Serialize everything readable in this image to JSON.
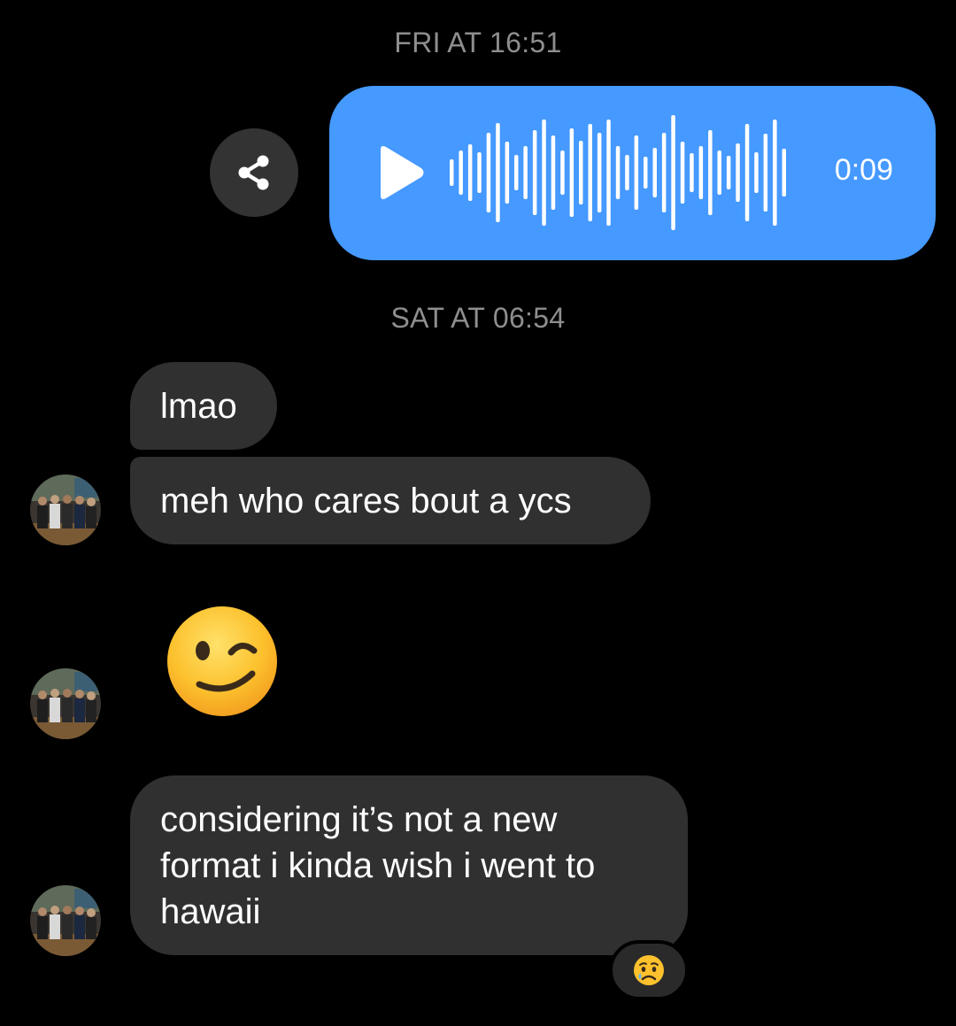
{
  "timestamps": {
    "first": "FRI AT 16:51",
    "second": "SAT AT 06:54"
  },
  "voice_message": {
    "duration": "0:09",
    "color": "#4599ff",
    "icons": [
      "play-icon",
      "waveform-icon",
      "share-icon"
    ]
  },
  "messages": [
    {
      "text": "lmao"
    },
    {
      "text": "meh who cares bout a ycs"
    },
    {
      "emoji": "winking-face"
    },
    {
      "lines": [
        "considering it’s not a new",
        "format i kinda wish i went to",
        "hawaii"
      ]
    }
  ],
  "reaction": {
    "emoji": "sad-but-relieved-face"
  },
  "colors": {
    "background": "#000000",
    "incoming_bubble": "#303030",
    "timestamp": "#8e8e8e"
  }
}
